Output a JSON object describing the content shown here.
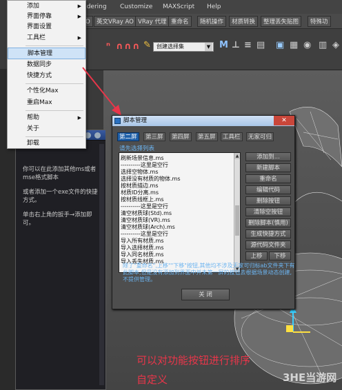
{
  "menubar": {
    "items": [
      "ndering",
      "Customize",
      "MAXScript",
      "Help"
    ]
  },
  "toolbar2": {
    "items": [
      "O",
      "英文VRay AO",
      "VRay 代理",
      "重命名",
      "随机操作",
      "材质转换",
      "整理丢失贴图",
      "特殊功"
    ]
  },
  "toolbar3": {
    "selection_set": "创建选择集"
  },
  "menu": {
    "items": [
      {
        "label": "添加",
        "submenu": true
      },
      {
        "label": "界面停靠",
        "submenu": true
      },
      {
        "label": "界面设置",
        "submenu": false
      },
      {
        "label": "工具栏",
        "submenu": true
      },
      {
        "label": "脚本管理",
        "submenu": false,
        "selected": true
      },
      {
        "label": "数据同步",
        "submenu": false
      },
      {
        "label": "快捷方式",
        "submenu": false
      },
      {
        "label": "个性化Max",
        "submenu": false
      },
      {
        "label": "重启Max",
        "submenu": false
      },
      {
        "label": "帮助",
        "submenu": true
      },
      {
        "label": "关于",
        "submenu": false
      },
      {
        "label": "卸载",
        "submenu": false
      }
    ],
    "submenu_glyph": "▶"
  },
  "leftpanel": {
    "lines": [
      "你可以在此添加其他ms或者mse格式脚本",
      "或者添加一个exe文件的快捷方式。",
      "单击右上角的扳手→添加即可。"
    ]
  },
  "dialog": {
    "title": "脚本管理",
    "close_glyph": "✕",
    "tabs": [
      "第二屏",
      "第三屏",
      "第四屏",
      "第五屏",
      "工具栏",
      "无家可归"
    ],
    "active_tab": 0,
    "list_label": "请先选择列表",
    "list_items": [
      "刷新场景信息.ms",
      "----------这里是空行",
      "选择空物体.ms",
      "选择没有材质的物体.ms",
      "按材质描边.ms",
      "材质ID分离.ms",
      "按材质线框上.ms",
      "----------这里是空行",
      "清空材质球(Std).ms",
      "清空材质球(VR).ms",
      "清空材质球(Arch).ms",
      "----------这里是空行",
      "导入所有材质.ms",
      "导入选择材质.ms",
      "导入同名材质.ms",
      "导入丢失材质.ms"
    ],
    "buttons": [
      "添加到...",
      "新建脚本",
      "重命名",
      "编辑代码",
      "删除按钮",
      "清除空按钮",
      "删除脚本(慎用)",
      "生成快捷方式",
      "源代码文件夹"
    ],
    "move_up": "上移",
    "move_down": "下移",
    "note": "除了\"重命名\",上移\"\"下移\"按钮,其他均不涉及无家可归标ab文件夹下有此脚本,但是没有添加到界面中并未第一屏的按钮去根据场景动态创建,不提供管理。",
    "close_label": "关 闭"
  },
  "annotation": {
    "line1": "可以对功能按钮进行排序",
    "line2": "自定义",
    "color": "#e8364a"
  },
  "watermark": "3HE当游网"
}
